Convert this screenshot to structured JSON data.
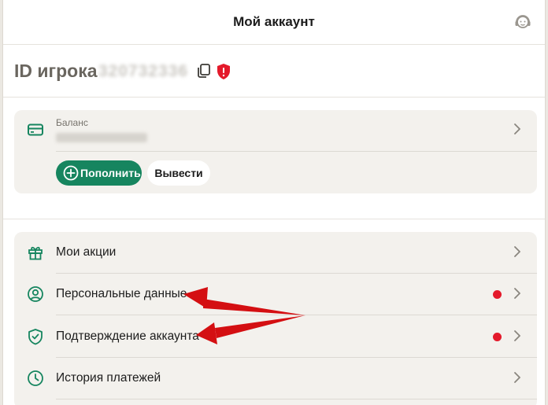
{
  "header": {
    "title": "Мой аккаунт",
    "support_icon": "headset-icon"
  },
  "player": {
    "id_label": "ID игрока",
    "id_value": "320732336"
  },
  "balance": {
    "label": "Баланс",
    "topup_label": "Пополнить",
    "withdraw_label": "Вывести"
  },
  "menu": {
    "items": [
      {
        "label": "Мои акции",
        "icon": "gift-icon",
        "alert": false
      },
      {
        "label": "Персональные данные",
        "icon": "user-circle-icon",
        "alert": true
      },
      {
        "label": "Подтверждение аккаунта",
        "icon": "shield-check-icon",
        "alert": true
      },
      {
        "label": "История платежей",
        "icon": "clock-icon",
        "alert": false
      }
    ]
  },
  "colors": {
    "accent": "#16855f",
    "alert": "#e41a2b",
    "annotation_arrow": "#d40f12",
    "background": "#f3f1ed"
  }
}
